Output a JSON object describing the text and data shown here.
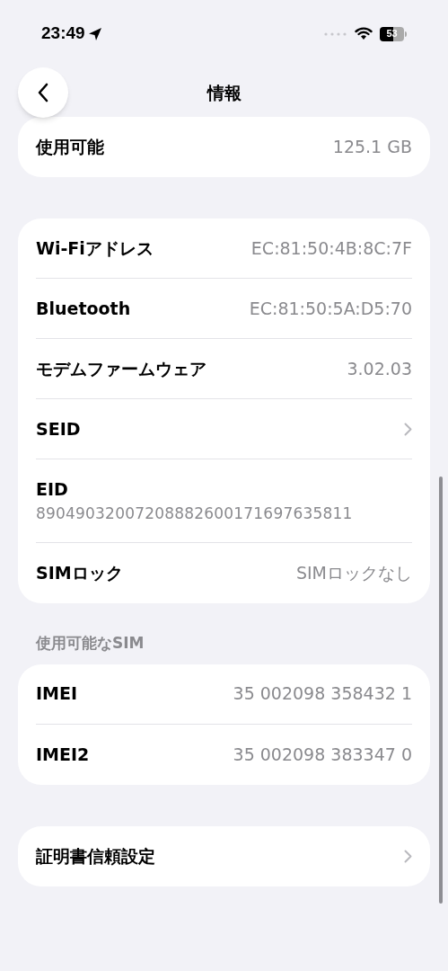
{
  "status_bar": {
    "time": "23:49",
    "battery": "53"
  },
  "nav": {
    "title": "情報"
  },
  "groups": [
    {
      "rows": [
        {
          "kind": "value",
          "label": "使用可能",
          "value": "125.1 GB"
        }
      ]
    },
    {
      "rows": [
        {
          "kind": "value",
          "label": "Wi-Fiアドレス",
          "value": "EC:81:50:4B:8C:7F"
        },
        {
          "kind": "value",
          "label": "Bluetooth",
          "value": "EC:81:50:5A:D5:70"
        },
        {
          "kind": "value",
          "label": "モデムファームウェア",
          "value": "3.02.03"
        },
        {
          "kind": "chevron",
          "label": "SEID"
        },
        {
          "kind": "stacked",
          "label": "EID",
          "value": "89049032007208882600171697635811"
        },
        {
          "kind": "value",
          "label": "SIMロック",
          "value": "SIMロックなし"
        }
      ]
    },
    {
      "header": "使用可能なSIM",
      "rows": [
        {
          "kind": "value",
          "label": "IMEI",
          "value": "35 002098 358432 1"
        },
        {
          "kind": "value",
          "label": "IMEI2",
          "value": "35 002098 383347 0"
        }
      ]
    },
    {
      "rows": [
        {
          "kind": "chevron",
          "label": "証明書信頼設定"
        }
      ]
    }
  ]
}
